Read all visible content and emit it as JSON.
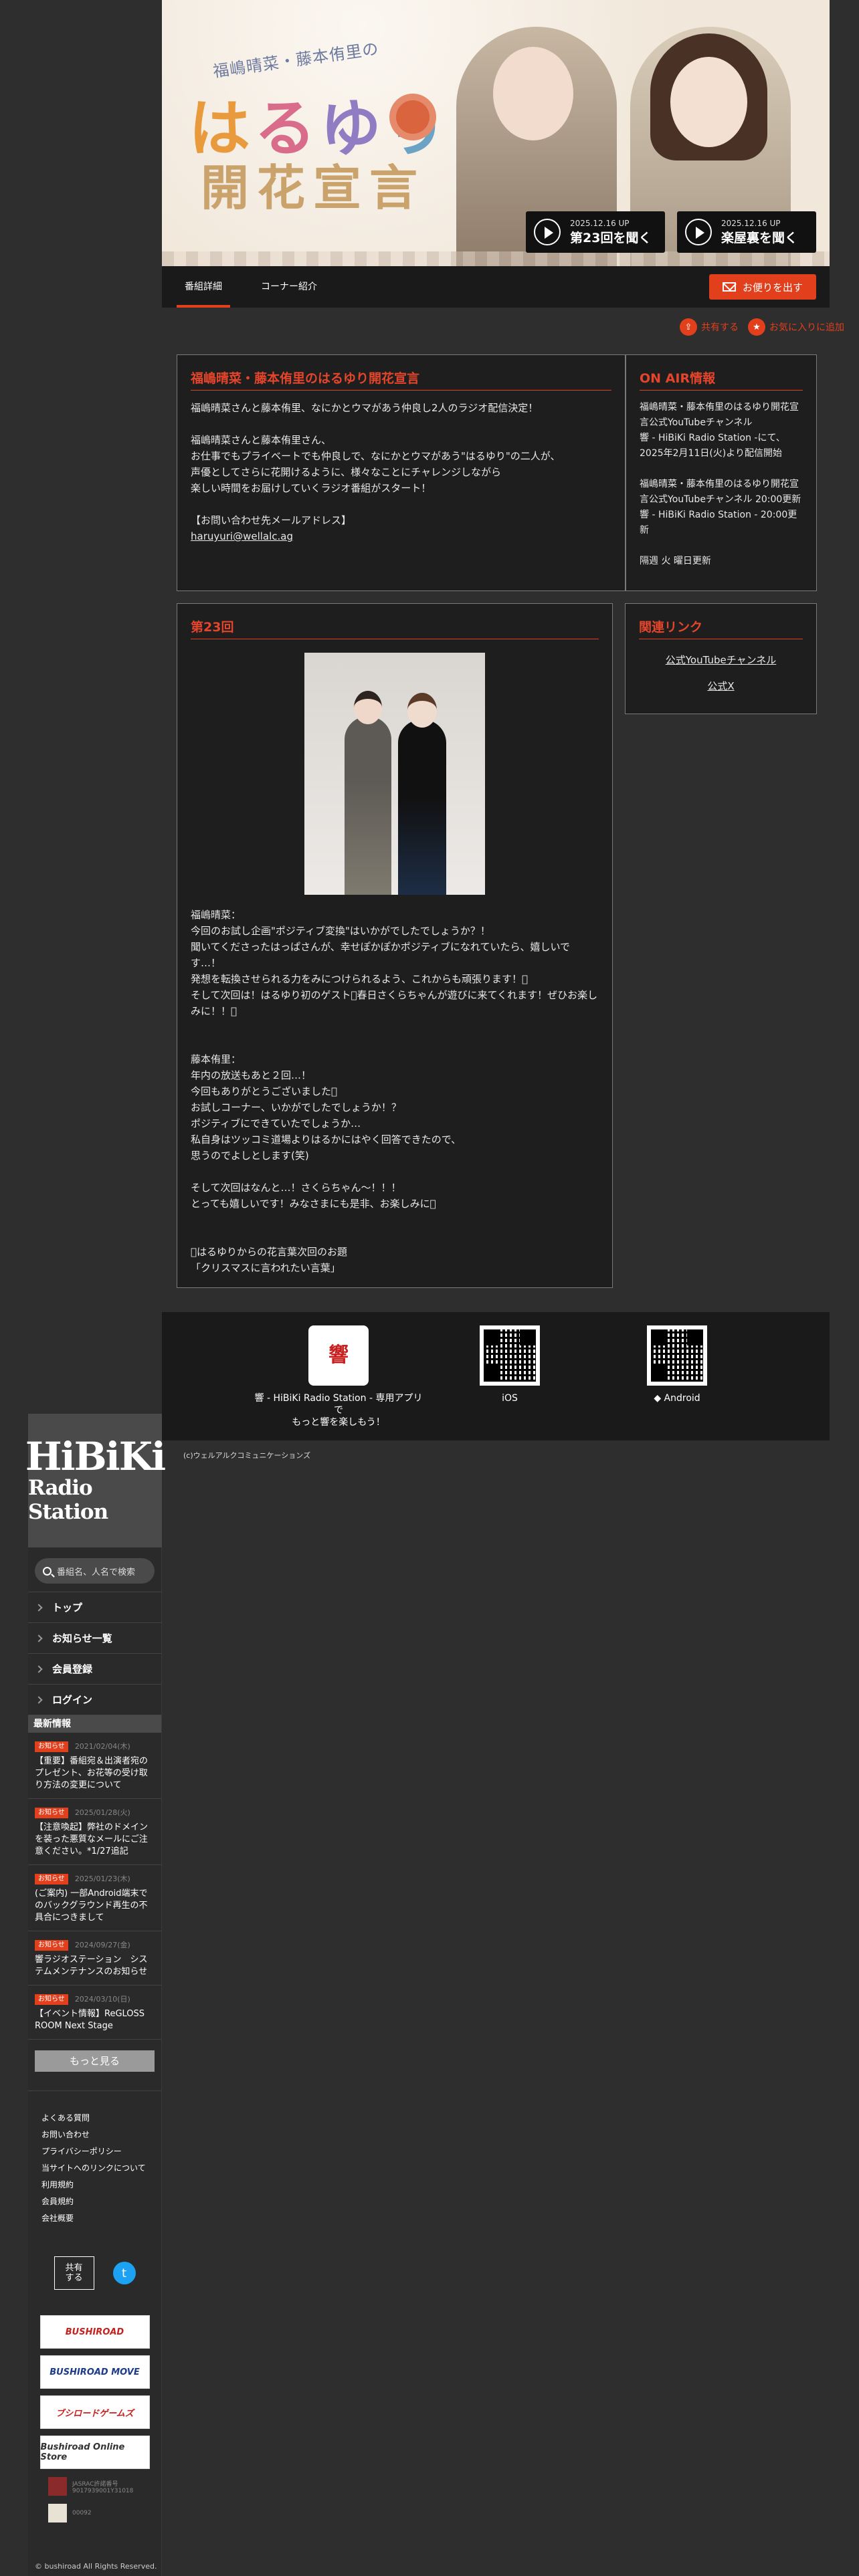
{
  "hero": {
    "subtitle": "福嶋晴菜・藤本侑里の",
    "title_chars": [
      "は",
      "る",
      "ゆ",
      "り"
    ],
    "title_line2": "開花宣言",
    "buttons": [
      {
        "date": "2025.12.16 UP",
        "label": "第23回を聞く"
      },
      {
        "date": "2025.12.16 UP",
        "label": "楽屋裏を聞く"
      }
    ]
  },
  "tabs": [
    "番組詳細",
    "コーナー紹介"
  ],
  "mail_button": "お便りを出す",
  "share": {
    "share": "共有する",
    "favorite": "お気に入りに追加"
  },
  "program": {
    "title": "福嶋晴菜・藤本侑里のはるゆり開花宣言",
    "body": "福嶋晴菜さんと藤本侑里、なにかとウマがあう仲良し2人のラジオ配信決定！\n\n福嶋晴菜さんと藤本侑里さん、\nお仕事でもプライベートでも仲良しで、なにかとウマがあう\"はるゆり\"の二人が、\n声優としてさらに花開けるように、様々なことにチャレンジしながら\n楽しい時間をお届けしていくラジオ番組がスタート！\n\n【お問い合わせ先メールアドレス】",
    "email": "haruyuri@wellalc.ag"
  },
  "onair": {
    "title": "ON AIR情報",
    "body": "福嶋晴菜・藤本侑里のはるゆり開花宣言公式YouTubeチャンネル\n響 - HiBiKi Radio Station -にて、\n2025年2月11日(火)より配信開始\n\n福嶋晴菜・藤本侑里のはるゆり開花宣言公式YouTubeチャンネル 20:00更新\n響 - HiBiKi Radio Station - 20:00更新\n\n隔週 火 曜日更新"
  },
  "episode": {
    "title": "第23回",
    "body": "福嶋晴菜：\n今回のお試し企画\"ポジティブ変換\"はいかがでしたでしょうか？！\n聞いてくださったはっぱさんが、幸せぽかぽかポジティブになれていたら、嬉しいです…！\n発想を転換させられる力をみにつけられるよう、これからも頑張ります！󾭛\nそして次回は！はるゆり初のゲスト󾬜春日さくらちゃんが遊びに来てくれます！ぜひお楽しみに！！󾬡\n\n\n藤本侑里：\n年内の放送もあと２回…！\n今回もありがとうございました󾬜\nお試しコーナー、いかがでしたでしょうか！？\nポジティブにできていたでしょうか…\n私自身はツッコミ道場よりはるかにはやく回答できたので、\n思うのでよしとします(笑)\n\nそして次回はなんと…！さくらちゃん〜！！！\nとっても嬉しいです！みなさまにも是非、お楽しみに󾬜\n\n\n󾬟はるゆりからの花言葉次回のお題\n「クリスマスに言われたい言葉」"
  },
  "related": {
    "title": "関連リンク",
    "links": [
      "公式YouTubeチャンネル",
      "公式X"
    ]
  },
  "apps": {
    "hibiki_logo": "響",
    "hibiki_label": "響 - HiBiKi Radio Station - 専用アプリで\nもっと響を楽しもう！",
    "ios": " iOS",
    "android": "◆ Android"
  },
  "main_copyright": "(c)ウェルアルクコミュニケーションズ",
  "sidebar": {
    "logo_line1": "HiBiKi",
    "logo_line2": "Radio Station",
    "search_placeholder": "番組名、人名で検索",
    "nav": [
      "トップ",
      "お知らせ一覧",
      "会員登録",
      "ログイン"
    ],
    "news_header": "最新情報",
    "news": [
      {
        "badge": "お知らせ",
        "date": "2021/02/04(木)",
        "text": "【重要】番組宛＆出演者宛のプレゼント、お花等の受け取り方法の変更について"
      },
      {
        "badge": "お知らせ",
        "date": "2025/01/28(火)",
        "text": "【注意喚起】弊社のドメインを装った悪質なメールにご注意ください。*1/27追記"
      },
      {
        "badge": "お知らせ",
        "date": "2025/01/23(木)",
        "text": "(ご案内) 一部Android端末でのバックグラウンド再生の不具合につきまして"
      },
      {
        "badge": "お知らせ",
        "date": "2024/09/27(金)",
        "text": "響ラジオステーション　システムメンテナンスのお知らせ"
      },
      {
        "badge": "お知らせ",
        "date": "2024/03/10(日)",
        "text": "【イベント情報】ReGLOSS ROOM Next Stage"
      }
    ],
    "more": "もっと見る",
    "links": [
      "よくある質問",
      "お問い合わせ",
      "プライバシーポリシー",
      "当サイトへのリンクについて",
      "利用規約",
      "会員規約",
      "会社概要"
    ],
    "share_label": "共有\nする",
    "banners": [
      "BUSHIROAD",
      "BUSHIROAD MOVE",
      "ブシロードゲームズ",
      "Bushiroad Online Store"
    ],
    "license1": "JASRAC許諾番号\n9017939001Y31018",
    "license2": "00092",
    "copyright": "© bushiroad All Rights Reserved."
  },
  "colors": {
    "accent": "#e23f1d",
    "bg": "#2e2e2e",
    "panel": "#1e1e1e"
  }
}
